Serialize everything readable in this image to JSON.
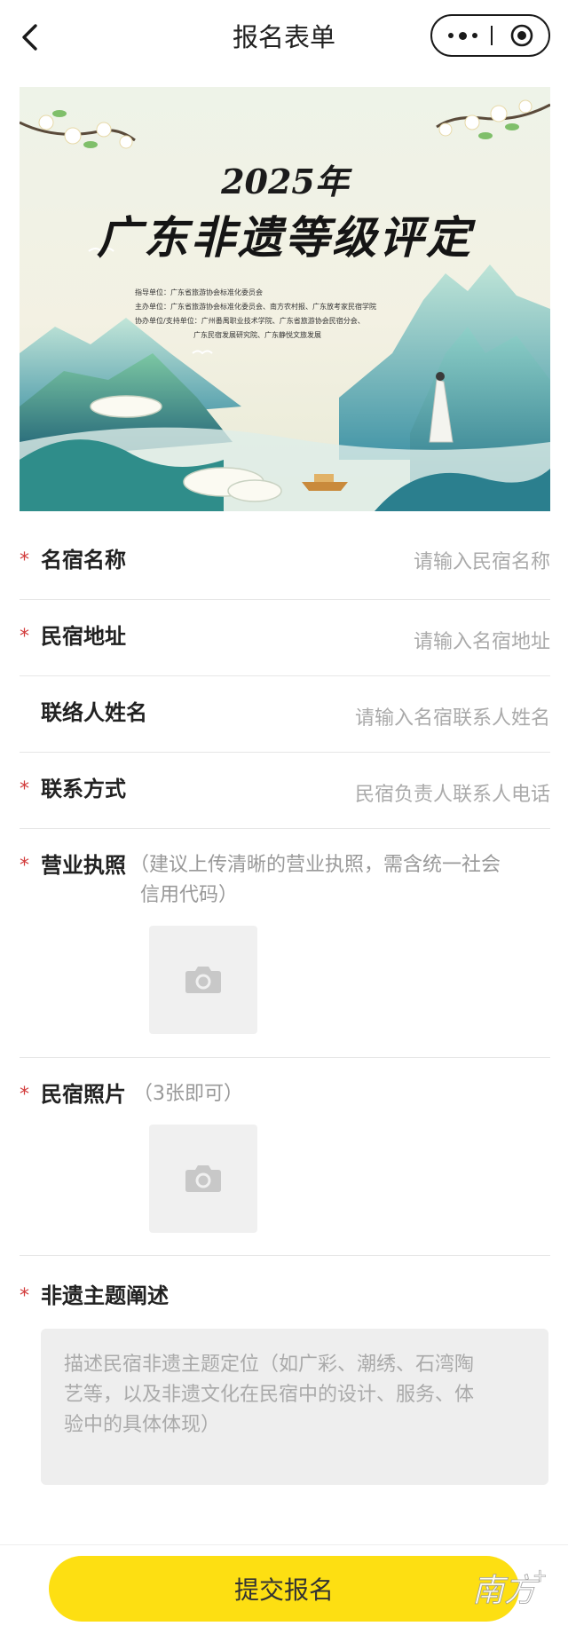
{
  "nav": {
    "title": "报名表单"
  },
  "banner": {
    "year": "2025年",
    "title": "广东非遗等级评定",
    "orgs": [
      "指导单位：广东省旅游协会标准化委员会",
      "主办单位：广东省旅游协会标准化委员会、南方农村报、广东放考家民宿学院",
      "协办单位/支持单位：广州番禺职业技术学院、广东省旅游协会民宿分会、",
      "广东民宿发展研究院、广东静悦文旅发展"
    ]
  },
  "form": {
    "name": {
      "label": "名宿名称",
      "placeholder": "请输入民宿名称",
      "required": true
    },
    "address": {
      "label": "民宿地址",
      "placeholder": "请输入名宿地址",
      "required": true
    },
    "contact_name": {
      "label": "联络人姓名",
      "placeholder": "请输入名宿联系人姓名",
      "required": false
    },
    "contact": {
      "label": "联系方式",
      "placeholder": "民宿负责人联系人电话",
      "required": true
    },
    "license": {
      "label": "营业执照",
      "hint_line1": "（建议上传清晰的营业执照，需含统一社会",
      "hint_line2": "信用代码）",
      "required": true
    },
    "photos": {
      "label": "民宿照片",
      "hint": "（3张即可）",
      "required": true
    },
    "theme": {
      "label": "非遗主题阐述",
      "placeholder_lines": [
        "描述民宿非遗主题定位（如广彩、潮绣、石湾陶",
        "艺等，以及非遗文化在民宿中的设计、服务、体",
        "验中的具体体现）"
      ],
      "required": true
    },
    "required_mark": "*"
  },
  "submit_label": "提交报名",
  "watermark": "南方+",
  "colors": {
    "accent": "#fddf12",
    "required": "#d23c3c",
    "placeholder": "#aaaaaa"
  }
}
